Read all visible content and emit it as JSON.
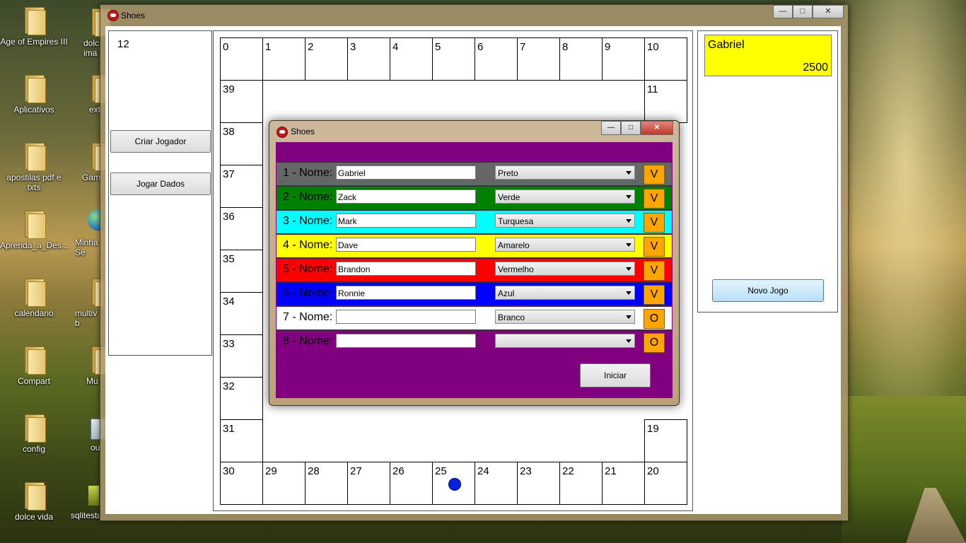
{
  "desktop": {
    "icons": [
      {
        "label": "Age of Empires III"
      },
      {
        "label": "Aplicativos"
      },
      {
        "label": "apostilas pdf e txts"
      },
      {
        "label": "Aprenda_a_Des..."
      },
      {
        "label": "calendario"
      },
      {
        "label": "Compart"
      },
      {
        "label": "config"
      },
      {
        "label": "dolce vida"
      }
    ],
    "partial_icons": [
      {
        "label": "dolc ima"
      },
      {
        "label": "ext"
      },
      {
        "label": "Gam"
      },
      {
        "label": "Minha Se"
      },
      {
        "label": "multiv b"
      },
      {
        "label": "Mu"
      },
      {
        "label": "ou"
      },
      {
        "label": "sqlitestu"
      }
    ]
  },
  "window": {
    "title": "Shoes",
    "controls": {
      "minimize": "—",
      "maximize": "□",
      "close": "✕"
    }
  },
  "left_panel": {
    "number": "12",
    "buttons": {
      "create_player": "Criar Jogador",
      "roll_dice": "Jogar Dados"
    }
  },
  "board": {
    "top_row": [
      "0",
      "1",
      "2",
      "3",
      "4",
      "5",
      "6",
      "7",
      "8",
      "9",
      "10"
    ],
    "right_col": [
      "11",
      "19"
    ],
    "left_col": [
      "39",
      "38",
      "37",
      "36",
      "35",
      "34",
      "33",
      "32",
      "31"
    ],
    "bottom_row": [
      "30",
      "29",
      "28",
      "27",
      "26",
      "25",
      "24",
      "23",
      "22",
      "21",
      "20"
    ],
    "token": {
      "cell": "25",
      "color": "#0a1fe0"
    }
  },
  "right_panel": {
    "player_card": {
      "name": "Gabriel",
      "money": "2500",
      "color": "#ffff00"
    },
    "new_game_button": "Novo Jogo"
  },
  "dialog": {
    "title": "Shoes",
    "controls": {
      "minimize": "—",
      "maximize": "□",
      "close": "✕"
    },
    "background_color": "#800080",
    "players": [
      {
        "label": "1 - Nome:",
        "name": "Gabriel",
        "color_option": "Preto",
        "status": "V",
        "row_color": "#666666"
      },
      {
        "label": "2 - Nome:",
        "name": "Zack",
        "color_option": "Verde",
        "status": "V",
        "row_color": "#008000"
      },
      {
        "label": "3 - Nome:",
        "name": "Mark",
        "color_option": "Turquesa",
        "status": "V",
        "row_color": "#00ffff"
      },
      {
        "label": "4 - Nome:",
        "name": "Dave",
        "color_option": "Amarelo",
        "status": "V",
        "row_color": "#ffff00"
      },
      {
        "label": "5 - Nome:",
        "name": "Brandon",
        "color_option": "Vermelho",
        "status": "V",
        "row_color": "#ff0000"
      },
      {
        "label": "6 - Nome:",
        "name": "Ronnie",
        "color_option": "Azul",
        "status": "V",
        "row_color": "#0000ff"
      },
      {
        "label": "7 - Nome:",
        "name": "",
        "color_option": "Branco",
        "status": "O",
        "row_color": "#ffffff"
      },
      {
        "label": "8 - Nome:",
        "name": "",
        "color_option": "",
        "status": "O",
        "row_color": "#800080"
      }
    ],
    "start_button": "Iniciar"
  }
}
